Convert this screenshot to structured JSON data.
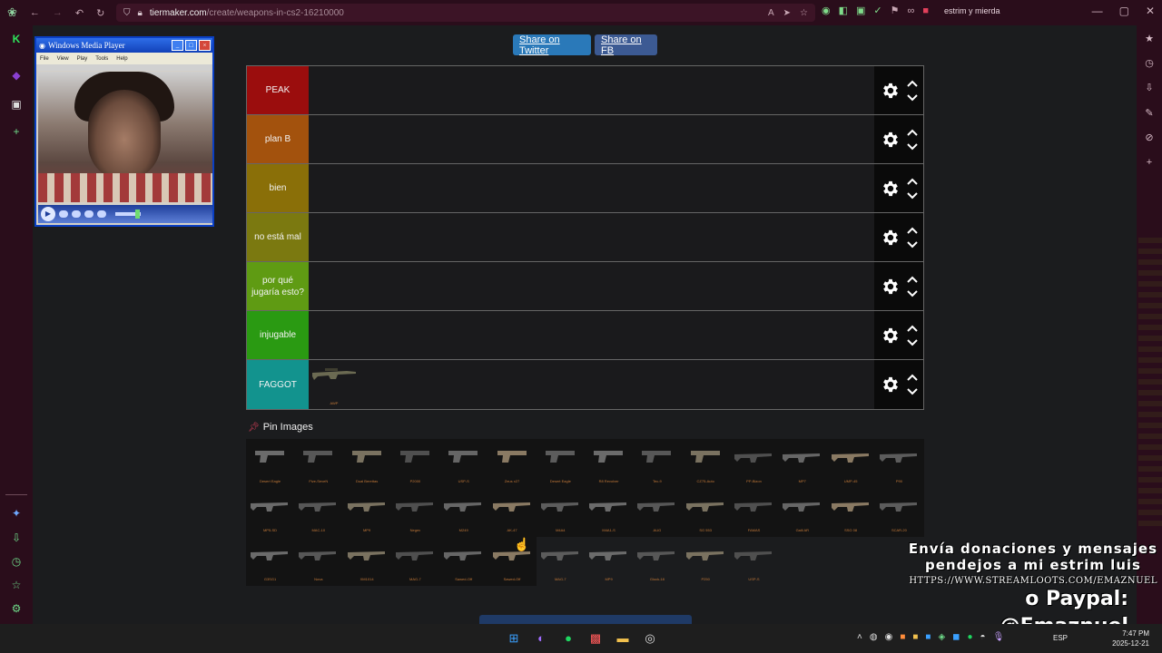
{
  "browser": {
    "url_host": "tiermaker.com",
    "url_path": "/create/weapons-in-cs2-16210000",
    "profile_label": "estrim y mierda",
    "nav_icons": [
      "back-icon",
      "forward-icon",
      "undo-icon",
      "reload-icon"
    ]
  },
  "share": {
    "twitter_label": "Share on Twitter",
    "fb_label": "Share on FB"
  },
  "tiers": [
    {
      "label": "PEAK",
      "color": "#9b0d0d"
    },
    {
      "label": "plan B",
      "color": "#a3520d"
    },
    {
      "label": "bien",
      "color": "#8a6f08"
    },
    {
      "label": "no está mal",
      "color": "#7b7910"
    },
    {
      "label": "por qué jugaría esto?",
      "color": "#5f9b13"
    },
    {
      "label": "injugable",
      "color": "#2a9a12"
    },
    {
      "label": "FAGGOT",
      "color": "#12938e"
    }
  ],
  "faggot_item_caption": "AWP",
  "pin_label": "Pin Images",
  "weapons": [
    "Desert Eagle",
    "Five-SeveN",
    "Dual Berettas",
    "P2000",
    "USP-S",
    "Zeus x27",
    "Desert Eagle",
    "R8 Revolver",
    "Tec-9",
    "CZ75-Auto",
    "PP-Bizon",
    "MP7",
    "UMP-45",
    "P90",
    "MP5-SD",
    "MAC-10",
    "MP9",
    "Negev",
    "M249",
    "AK-47",
    "M4A4",
    "M4A1-S",
    "AUG",
    "SG 553",
    "FAMAS",
    "Galil AR",
    "SSG 08",
    "SCAR-20",
    "G3SG1",
    "Nova",
    "XM1014",
    "MAG-7",
    "Sawed-Off",
    "Sawed-Off",
    "MAG-7",
    "MP9",
    "Glock-18",
    "P250",
    "USP-S"
  ],
  "wmp": {
    "title": "Windows Media Player",
    "menu": [
      "File",
      "View",
      "Play",
      "Tools",
      "Help"
    ]
  },
  "overlay": {
    "line1": "Envía donaciones y mensajes",
    "line2": "pendejos a mi estrim luis",
    "line3": "HTTPS://WWW.STREAMLOOTS.COM/EMAZNUEL",
    "line4": "o Paypal: @Emaznuel"
  },
  "taskbar": {
    "lang": "ESP",
    "time": "7:47 PM",
    "date": "2025-12-21"
  },
  "colors": {
    "browser_chrome": "#2a0d1b",
    "page_bg": "#1b1c1e",
    "twitter_blue": "#2a79b9",
    "fb_blue": "#3c5a93"
  }
}
